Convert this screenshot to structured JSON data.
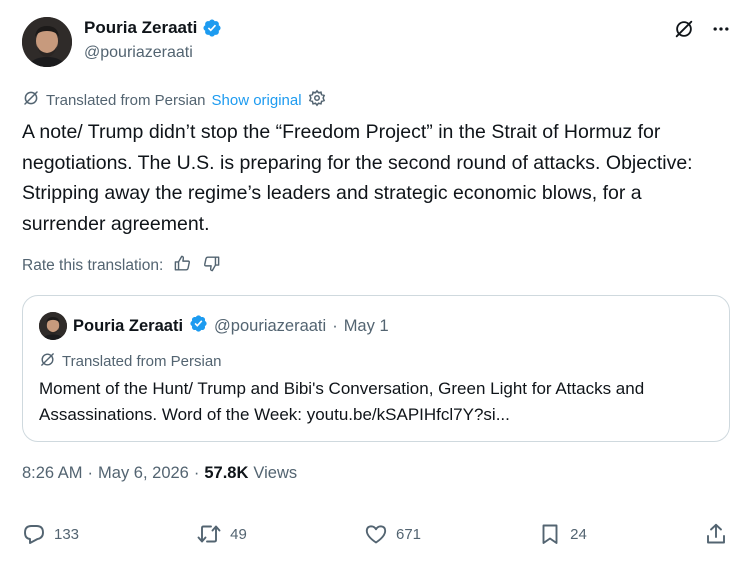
{
  "author": {
    "name": "Pouria Zeraati",
    "handle": "@pouriazeraati"
  },
  "translation": {
    "label": "Translated from Persian",
    "show_original": "Show original"
  },
  "tweet": {
    "text": "A note/ Trump didn’t stop the “Freedom Project” in the Strait of Hormuz for negotiations. The U.S. is preparing for the second round of attacks. Objective: Stripping away the regime’s leaders and strategic economic blows, for a surrender agreement."
  },
  "rate": {
    "label": "Rate this translation:"
  },
  "quote": {
    "name": "Pouria Zeraati",
    "handle": "@pouriazeraati",
    "separator": "·",
    "date": "May 1",
    "translated": "Translated from Persian",
    "text": "Moment of the Hunt/ Trump and Bibi's Conversation, Green Light for Attacks and Assassinations. Word of the Week: youtu.be/kSAPIHfcl7Y?si..."
  },
  "meta": {
    "time": "8:26 AM",
    "sep1": "·",
    "date": "May 6, 2026",
    "sep2": "·",
    "views_count": "57.8K",
    "views_label": "Views"
  },
  "actions": {
    "replies": "133",
    "reposts": "49",
    "likes": "671",
    "bookmarks": "24"
  },
  "colors": {
    "accent": "#1d9bf0",
    "secondary_text": "#536471",
    "primary_text": "#0f1419",
    "border": "#cfd9de"
  }
}
